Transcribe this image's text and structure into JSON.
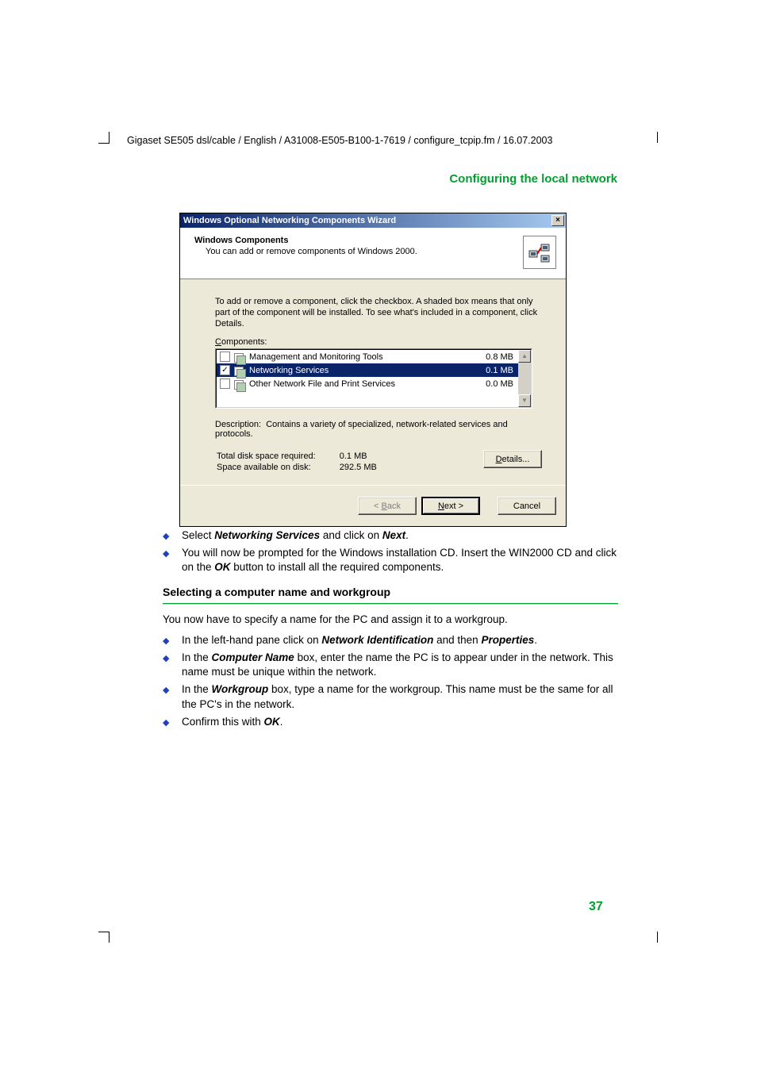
{
  "header_line": "Gigaset SE505 dsl/cable / English / A31008-E505-B100-1-7619 / configure_tcpip.fm / 16.07.2003",
  "section_title": "Configuring the local network",
  "dialog": {
    "title": "Windows Optional Networking Components Wizard",
    "close_glyph": "×",
    "header_bold": "Windows Components",
    "header_sub": "You can add or remove components of Windows 2000.",
    "intro": "To add or remove a component, click the checkbox. A shaded box means that only part of the component will be installed. To see what's included in a component, click Details.",
    "components_label": "Components:",
    "rows": [
      {
        "checked": false,
        "label": "Management and Monitoring Tools",
        "size": "0.8 MB",
        "selected": false
      },
      {
        "checked": true,
        "label": "Networking Services",
        "size": "0.1 MB",
        "selected": true
      },
      {
        "checked": false,
        "label": "Other Network File and Print Services",
        "size": "0.0 MB",
        "selected": false
      }
    ],
    "scroll_up": "▲",
    "scroll_down": "▼",
    "description_label": "Description:",
    "description_text": "Contains a variety of specialized, network-related services and protocols.",
    "space_required_label": "Total disk space required:",
    "space_required_value": "0.1 MB",
    "space_available_label": "Space available on disk:",
    "space_available_value": "292.5 MB",
    "details_btn": "Details...",
    "back_btn": "< Back",
    "next_btn": "Next >",
    "cancel_btn": "Cancel"
  },
  "doc": {
    "bullets1": {
      "b0_pre": "Select ",
      "b0_bold1": "Networking Services",
      "b0_mid": " and click on ",
      "b0_bold2": "Next",
      "b0_post": ".",
      "b1_pre": "You will now be prompted for the Windows installation CD. Insert the WIN2000 CD and click on the ",
      "b1_bold": "OK",
      "b1_post": " button to install all the required components."
    },
    "subheading": "Selecting a computer name and workgroup",
    "para1": "You now have to specify a name for the PC and assign it to a workgroup.",
    "bullets2": {
      "b0_pre": "In the left-hand pane click on ",
      "b0_bold1": "Network Identification",
      "b0_mid": " and then ",
      "b0_bold2": "Properties",
      "b0_post": ".",
      "b1_pre": "In the ",
      "b1_bold": "Computer Name",
      "b1_post": " box, enter the name the PC is to appear under in the network. This name must be unique within the network.",
      "b2_pre": "In the ",
      "b2_bold": "Workgroup",
      "b2_post": " box, type a name for the workgroup. This name must be the same for all the PC's in the network.",
      "b3_pre": "Confirm this with ",
      "b3_bold": "OK",
      "b3_post": "."
    }
  },
  "page_number": "37"
}
